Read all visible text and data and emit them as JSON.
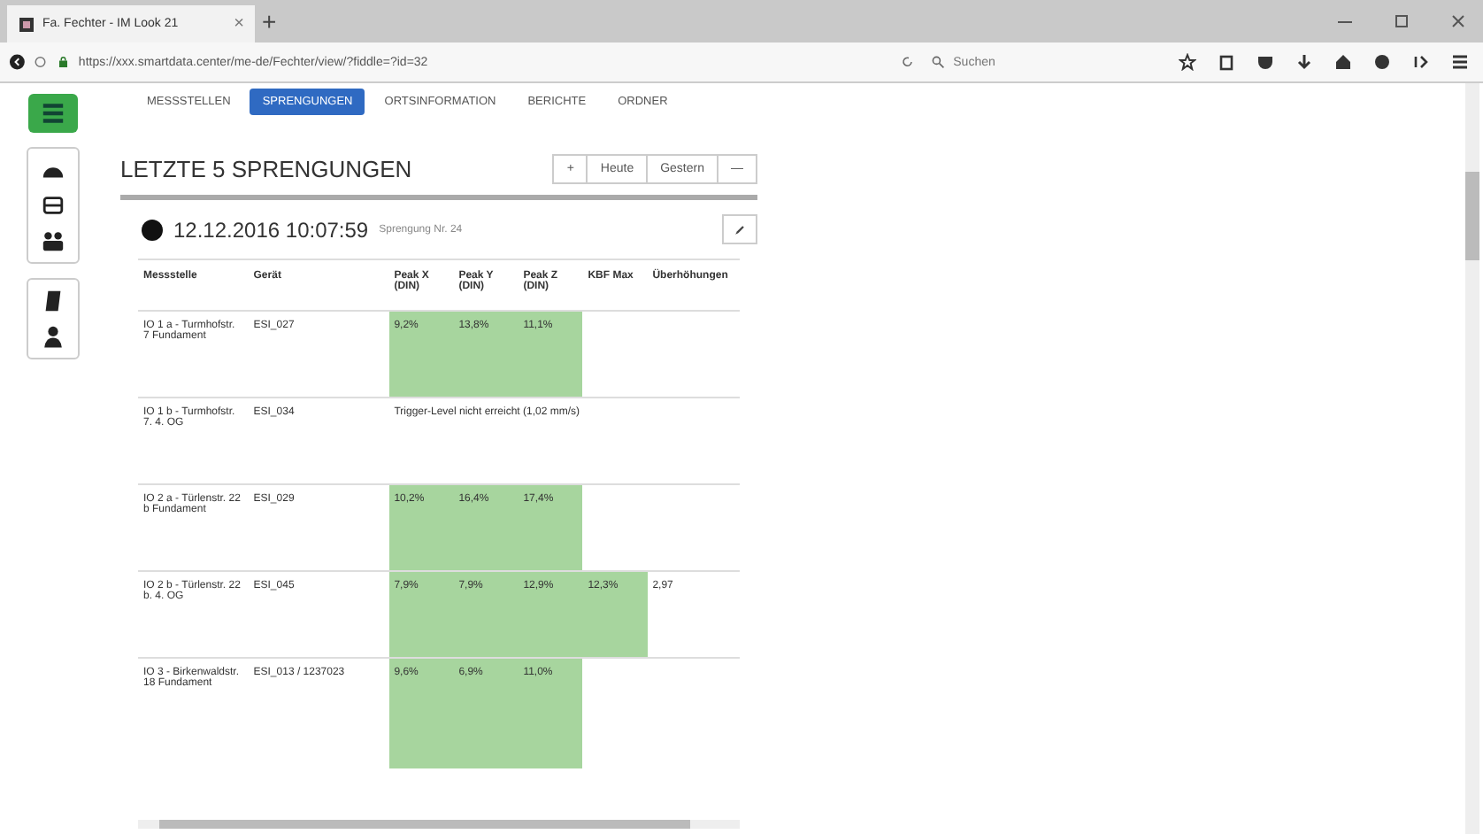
{
  "browser": {
    "tab_title": "Fa. Fechter - IM Look 21",
    "tab_close": "×",
    "new_tab": "+",
    "url": "https://xxx.smartdata.center/me-de/Fechter/view/?fiddle=?id=32",
    "search": {
      "placeholder": "Suchen"
    }
  },
  "nav_tabs": [
    {
      "label": "MESSSTELLEN",
      "selected": false
    },
    {
      "label": "SPRENGUNGEN",
      "selected": true
    },
    {
      "label": "ORTSINFORMATION",
      "selected": false
    },
    {
      "label": "BERICHTE",
      "selected": false
    },
    {
      "label": "ORDNER",
      "selected": false
    }
  ],
  "section": {
    "title": "LETZTE 5 SPRENGUNGEN",
    "buttons": [
      {
        "label": "+"
      },
      {
        "label": "Heute"
      },
      {
        "label": "Gestern"
      },
      {
        "label": "—"
      }
    ]
  },
  "blast": {
    "datetime": "12.12.2016 10:07:59",
    "subtitle": "Sprengung Nr. 24"
  },
  "table": {
    "columns": [
      "Messstelle",
      "Gerät",
      "Peak X (DIN)",
      "Peak Y (DIN)",
      "Peak Z (DIN)",
      "KBF Max",
      "Überhöhungen"
    ],
    "rows": [
      {
        "location": "IO 1 a - Turmhofstr. 7 Fundament",
        "device": "ESI_027",
        "values": [
          {
            "text": "9,2%",
            "highlighted": true
          },
          {
            "text": "13,8%",
            "highlighted": true
          },
          {
            "text": "11,1%",
            "highlighted": true
          }
        ]
      },
      {
        "location": "IO 1 b - Turmhofstr. 7. 4. OG",
        "device": "ESI_034",
        "note": "Trigger-Level nicht erreicht (1,02 mm/s)"
      },
      {
        "location": "IO 2 a - Türlenstr. 22 b Fundament",
        "device": "ESI_029",
        "values": [
          {
            "text": "10,2%",
            "highlighted": true
          },
          {
            "text": "16,4%",
            "highlighted": true
          },
          {
            "text": "17,4%",
            "highlighted": true
          }
        ]
      },
      {
        "location": "IO 2 b - Türlenstr. 22 b. 4. OG",
        "device": "ESI_045",
        "values": [
          {
            "text": "7,9%",
            "highlighted": true
          },
          {
            "text": "7,9%",
            "highlighted": true
          },
          {
            "text": "12,9%",
            "highlighted": true
          },
          {
            "text": "12,3%",
            "highlighted": true
          }
        ],
        "overhang": "2,97"
      },
      {
        "location": "IO 3 - Birkenwaldstr. 18 Fundament",
        "device": "ESI_013 / 1237023",
        "values": [
          {
            "text": "9,6%",
            "highlighted": true
          },
          {
            "text": "6,9%",
            "highlighted": true
          },
          {
            "text": "11,0%",
            "highlighted": true
          }
        ]
      }
    ]
  }
}
